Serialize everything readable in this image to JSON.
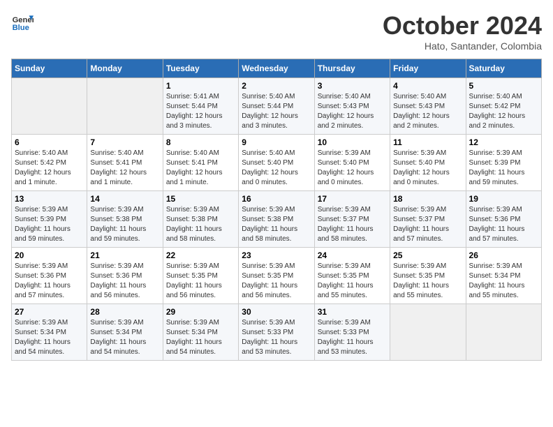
{
  "logo": {
    "line1": "General",
    "line2": "Blue"
  },
  "title": "October 2024",
  "subtitle": "Hato, Santander, Colombia",
  "days_of_week": [
    "Sunday",
    "Monday",
    "Tuesday",
    "Wednesday",
    "Thursday",
    "Friday",
    "Saturday"
  ],
  "weeks": [
    [
      {
        "day": "",
        "info": ""
      },
      {
        "day": "",
        "info": ""
      },
      {
        "day": "1",
        "info": "Sunrise: 5:41 AM\nSunset: 5:44 PM\nDaylight: 12 hours\nand 3 minutes."
      },
      {
        "day": "2",
        "info": "Sunrise: 5:40 AM\nSunset: 5:44 PM\nDaylight: 12 hours\nand 3 minutes."
      },
      {
        "day": "3",
        "info": "Sunrise: 5:40 AM\nSunset: 5:43 PM\nDaylight: 12 hours\nand 2 minutes."
      },
      {
        "day": "4",
        "info": "Sunrise: 5:40 AM\nSunset: 5:43 PM\nDaylight: 12 hours\nand 2 minutes."
      },
      {
        "day": "5",
        "info": "Sunrise: 5:40 AM\nSunset: 5:42 PM\nDaylight: 12 hours\nand 2 minutes."
      }
    ],
    [
      {
        "day": "6",
        "info": "Sunrise: 5:40 AM\nSunset: 5:42 PM\nDaylight: 12 hours\nand 1 minute."
      },
      {
        "day": "7",
        "info": "Sunrise: 5:40 AM\nSunset: 5:41 PM\nDaylight: 12 hours\nand 1 minute."
      },
      {
        "day": "8",
        "info": "Sunrise: 5:40 AM\nSunset: 5:41 PM\nDaylight: 12 hours\nand 1 minute."
      },
      {
        "day": "9",
        "info": "Sunrise: 5:40 AM\nSunset: 5:40 PM\nDaylight: 12 hours\nand 0 minutes."
      },
      {
        "day": "10",
        "info": "Sunrise: 5:39 AM\nSunset: 5:40 PM\nDaylight: 12 hours\nand 0 minutes."
      },
      {
        "day": "11",
        "info": "Sunrise: 5:39 AM\nSunset: 5:40 PM\nDaylight: 12 hours\nand 0 minutes."
      },
      {
        "day": "12",
        "info": "Sunrise: 5:39 AM\nSunset: 5:39 PM\nDaylight: 11 hours\nand 59 minutes."
      }
    ],
    [
      {
        "day": "13",
        "info": "Sunrise: 5:39 AM\nSunset: 5:39 PM\nDaylight: 11 hours\nand 59 minutes."
      },
      {
        "day": "14",
        "info": "Sunrise: 5:39 AM\nSunset: 5:38 PM\nDaylight: 11 hours\nand 59 minutes."
      },
      {
        "day": "15",
        "info": "Sunrise: 5:39 AM\nSunset: 5:38 PM\nDaylight: 11 hours\nand 58 minutes."
      },
      {
        "day": "16",
        "info": "Sunrise: 5:39 AM\nSunset: 5:38 PM\nDaylight: 11 hours\nand 58 minutes."
      },
      {
        "day": "17",
        "info": "Sunrise: 5:39 AM\nSunset: 5:37 PM\nDaylight: 11 hours\nand 58 minutes."
      },
      {
        "day": "18",
        "info": "Sunrise: 5:39 AM\nSunset: 5:37 PM\nDaylight: 11 hours\nand 57 minutes."
      },
      {
        "day": "19",
        "info": "Sunrise: 5:39 AM\nSunset: 5:36 PM\nDaylight: 11 hours\nand 57 minutes."
      }
    ],
    [
      {
        "day": "20",
        "info": "Sunrise: 5:39 AM\nSunset: 5:36 PM\nDaylight: 11 hours\nand 57 minutes."
      },
      {
        "day": "21",
        "info": "Sunrise: 5:39 AM\nSunset: 5:36 PM\nDaylight: 11 hours\nand 56 minutes."
      },
      {
        "day": "22",
        "info": "Sunrise: 5:39 AM\nSunset: 5:35 PM\nDaylight: 11 hours\nand 56 minutes."
      },
      {
        "day": "23",
        "info": "Sunrise: 5:39 AM\nSunset: 5:35 PM\nDaylight: 11 hours\nand 56 minutes."
      },
      {
        "day": "24",
        "info": "Sunrise: 5:39 AM\nSunset: 5:35 PM\nDaylight: 11 hours\nand 55 minutes."
      },
      {
        "day": "25",
        "info": "Sunrise: 5:39 AM\nSunset: 5:35 PM\nDaylight: 11 hours\nand 55 minutes."
      },
      {
        "day": "26",
        "info": "Sunrise: 5:39 AM\nSunset: 5:34 PM\nDaylight: 11 hours\nand 55 minutes."
      }
    ],
    [
      {
        "day": "27",
        "info": "Sunrise: 5:39 AM\nSunset: 5:34 PM\nDaylight: 11 hours\nand 54 minutes."
      },
      {
        "day": "28",
        "info": "Sunrise: 5:39 AM\nSunset: 5:34 PM\nDaylight: 11 hours\nand 54 minutes."
      },
      {
        "day": "29",
        "info": "Sunrise: 5:39 AM\nSunset: 5:34 PM\nDaylight: 11 hours\nand 54 minutes."
      },
      {
        "day": "30",
        "info": "Sunrise: 5:39 AM\nSunset: 5:33 PM\nDaylight: 11 hours\nand 53 minutes."
      },
      {
        "day": "31",
        "info": "Sunrise: 5:39 AM\nSunset: 5:33 PM\nDaylight: 11 hours\nand 53 minutes."
      },
      {
        "day": "",
        "info": ""
      },
      {
        "day": "",
        "info": ""
      }
    ]
  ]
}
